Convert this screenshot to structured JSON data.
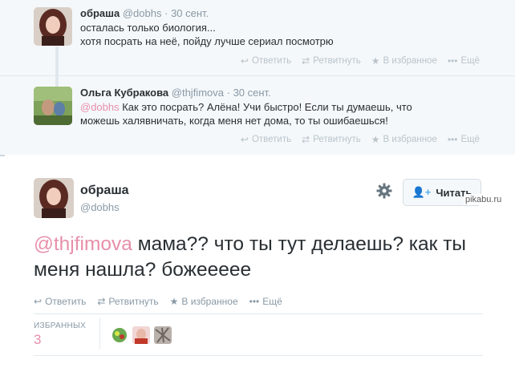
{
  "thread": [
    {
      "fullname": "обраша",
      "screen_name": "@dobhs",
      "dot": "·",
      "time": "30 сент.",
      "text_line1": "осталась только биология...",
      "text_line2": "хотя посрать на неё, пойду лучше сериал посмотрю",
      "actions": {
        "reply": "Ответить",
        "retweet": "Ретвитнуть",
        "favorite": "В избранное",
        "more": "Ещё"
      }
    },
    {
      "fullname": "Ольга Кубракова",
      "screen_name": "@thjfimova",
      "dot": "·",
      "time": "30 сент.",
      "mention": "@dobhs",
      "text_rest": " Как это посрать? Алёна! Учи быстро! Если ты думаешь, что можешь халявничать, когда меня нет дома, то ты ошибаешься!",
      "actions": {
        "reply": "Ответить",
        "retweet": "Ретвитнуть",
        "favorite": "В избранное",
        "more": "Ещё"
      }
    }
  ],
  "main": {
    "fullname": "обраша",
    "screen_name": "@dobhs",
    "follow_label": "Читать",
    "mention": "@thjfimova",
    "text_rest": " мама?? что ты тут делаешь? как ты меня нашла? божеееее",
    "actions": {
      "reply": "Ответить",
      "retweet": "Ретвитнуть",
      "favorite": "В избранное",
      "more": "Ещё"
    },
    "favorites_label": "ИЗБРАННЫХ",
    "favorites_count": "3"
  },
  "watermark": "pikabu.ru",
  "colors": {
    "accent": "#e78faa",
    "muted": "#8899a6",
    "follow_icon": "#55acee",
    "thread_bg": "#f5f8fa"
  },
  "icons": {
    "reply": "reply-icon",
    "retweet": "retweet-icon",
    "favorite": "star-icon",
    "more": "more-dots-icon",
    "settings": "gear-icon",
    "follow": "add-user-icon"
  }
}
